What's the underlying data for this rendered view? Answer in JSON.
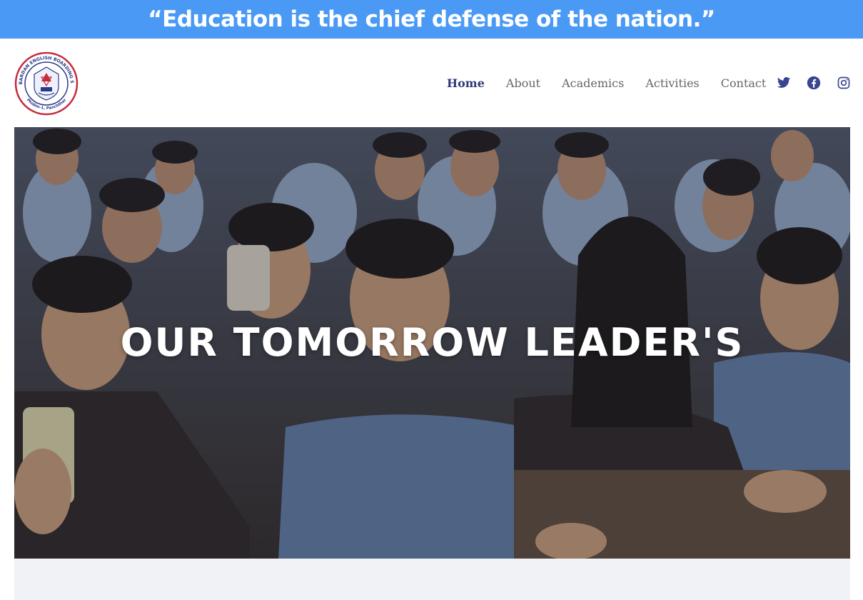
{
  "banner": {
    "quote": "“Education is the chief defense of the nation.”",
    "background": "#4a9af5"
  },
  "logo": {
    "ring_text": "VIDYA BARDAN ENGLISH BOARDING SCHOOL",
    "location_text": "Phidim-1, Panchthar",
    "alt": "school-logo"
  },
  "nav": {
    "items": [
      {
        "label": "Home",
        "active": true
      },
      {
        "label": "About",
        "active": false
      },
      {
        "label": "Academics",
        "active": false
      },
      {
        "label": "Activities",
        "active": false
      },
      {
        "label": "Contact",
        "active": false
      }
    ],
    "active_color": "#2f3a7a"
  },
  "social": {
    "icons": [
      "twitter-icon",
      "facebook-icon",
      "instagram-icon"
    ],
    "color": "#3a4591"
  },
  "hero": {
    "title": "OUR TOMORROW LEADER'S",
    "image_description": "students-in-classroom-photo"
  }
}
